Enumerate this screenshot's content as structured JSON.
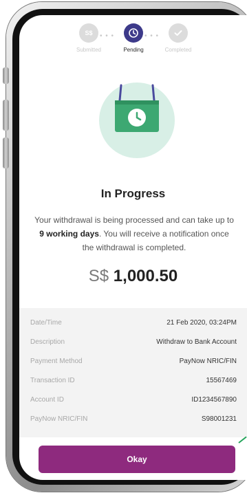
{
  "stepper": {
    "steps": [
      {
        "label": "Submitted",
        "icon": "dollar-icon",
        "state": "done",
        "icon_text": "S$"
      },
      {
        "label": "Pending",
        "icon": "clock-icon",
        "state": "active"
      },
      {
        "label": "Completed",
        "icon": "check-icon",
        "state": "pending"
      }
    ]
  },
  "status": {
    "title": "In Progress",
    "description_pre": "Your withdrawal is being processed and can take up to ",
    "description_bold": "9 working days",
    "description_post": ". You will receive a notification once the withdrawal is completed."
  },
  "amount": {
    "currency": "S$",
    "value": "1,000.50"
  },
  "details": [
    {
      "label": "Date/Time",
      "value": "21 Feb 2020, 03:24PM"
    },
    {
      "label": "Description",
      "value": "Withdraw to Bank Account"
    },
    {
      "label": "Payment Method",
      "value": "PayNow NRIC/FIN"
    },
    {
      "label": "Transaction ID",
      "value": "15567469"
    },
    {
      "label": "Account ID",
      "value": "ID1234567890"
    },
    {
      "label": "PayNow NRIC/FIN",
      "value": "S98001231"
    }
  ],
  "actions": {
    "okay_label": "Okay"
  },
  "colors": {
    "accent": "#8e2a7e",
    "stepper_active": "#3d3a8a",
    "illustration_bg": "#d8efe6",
    "illustration_card": "#3da872"
  }
}
